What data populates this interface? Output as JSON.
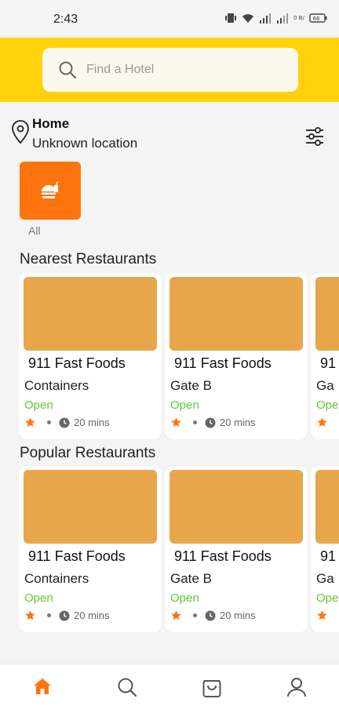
{
  "status_bar": {
    "time": "2:43",
    "net_speed": "0 B/S",
    "battery": "66"
  },
  "search": {
    "placeholder": "Find a Hotel",
    "value": ""
  },
  "location": {
    "title": "Home",
    "subtitle": "Unknown location"
  },
  "categories": [
    {
      "label": "All",
      "icon": "burger-drink-icon"
    }
  ],
  "sections": [
    {
      "title": "Nearest Restaurants",
      "cards": [
        {
          "name": "911 Fast Foods",
          "sub": "Containers",
          "status": "Open",
          "time": "20 mins"
        },
        {
          "name": "911 Fast Foods",
          "sub": "Gate B",
          "status": "Open",
          "time": "20 mins"
        },
        {
          "name": "91",
          "sub": "Ga",
          "status": "Ope",
          "time": ""
        }
      ]
    },
    {
      "title": "Popular Restaurants",
      "cards": [
        {
          "name": "911 Fast Foods",
          "sub": "Containers",
          "status": "Open",
          "time": "20 mins"
        },
        {
          "name": "911 Fast Foods",
          "sub": "Gate B",
          "status": "Open",
          "time": "20 mins"
        },
        {
          "name": "91",
          "sub": "Ga",
          "status": "Ope",
          "time": ""
        }
      ]
    }
  ],
  "bottom_nav": [
    {
      "icon": "home-icon",
      "active": true
    },
    {
      "icon": "search-icon",
      "active": false
    },
    {
      "icon": "cart-icon",
      "active": false
    },
    {
      "icon": "profile-icon",
      "active": false
    }
  ],
  "colors": {
    "accent": "#ff740f",
    "header": "#ffd20a",
    "open": "#5fc93a",
    "background": "#f4f4f4"
  }
}
